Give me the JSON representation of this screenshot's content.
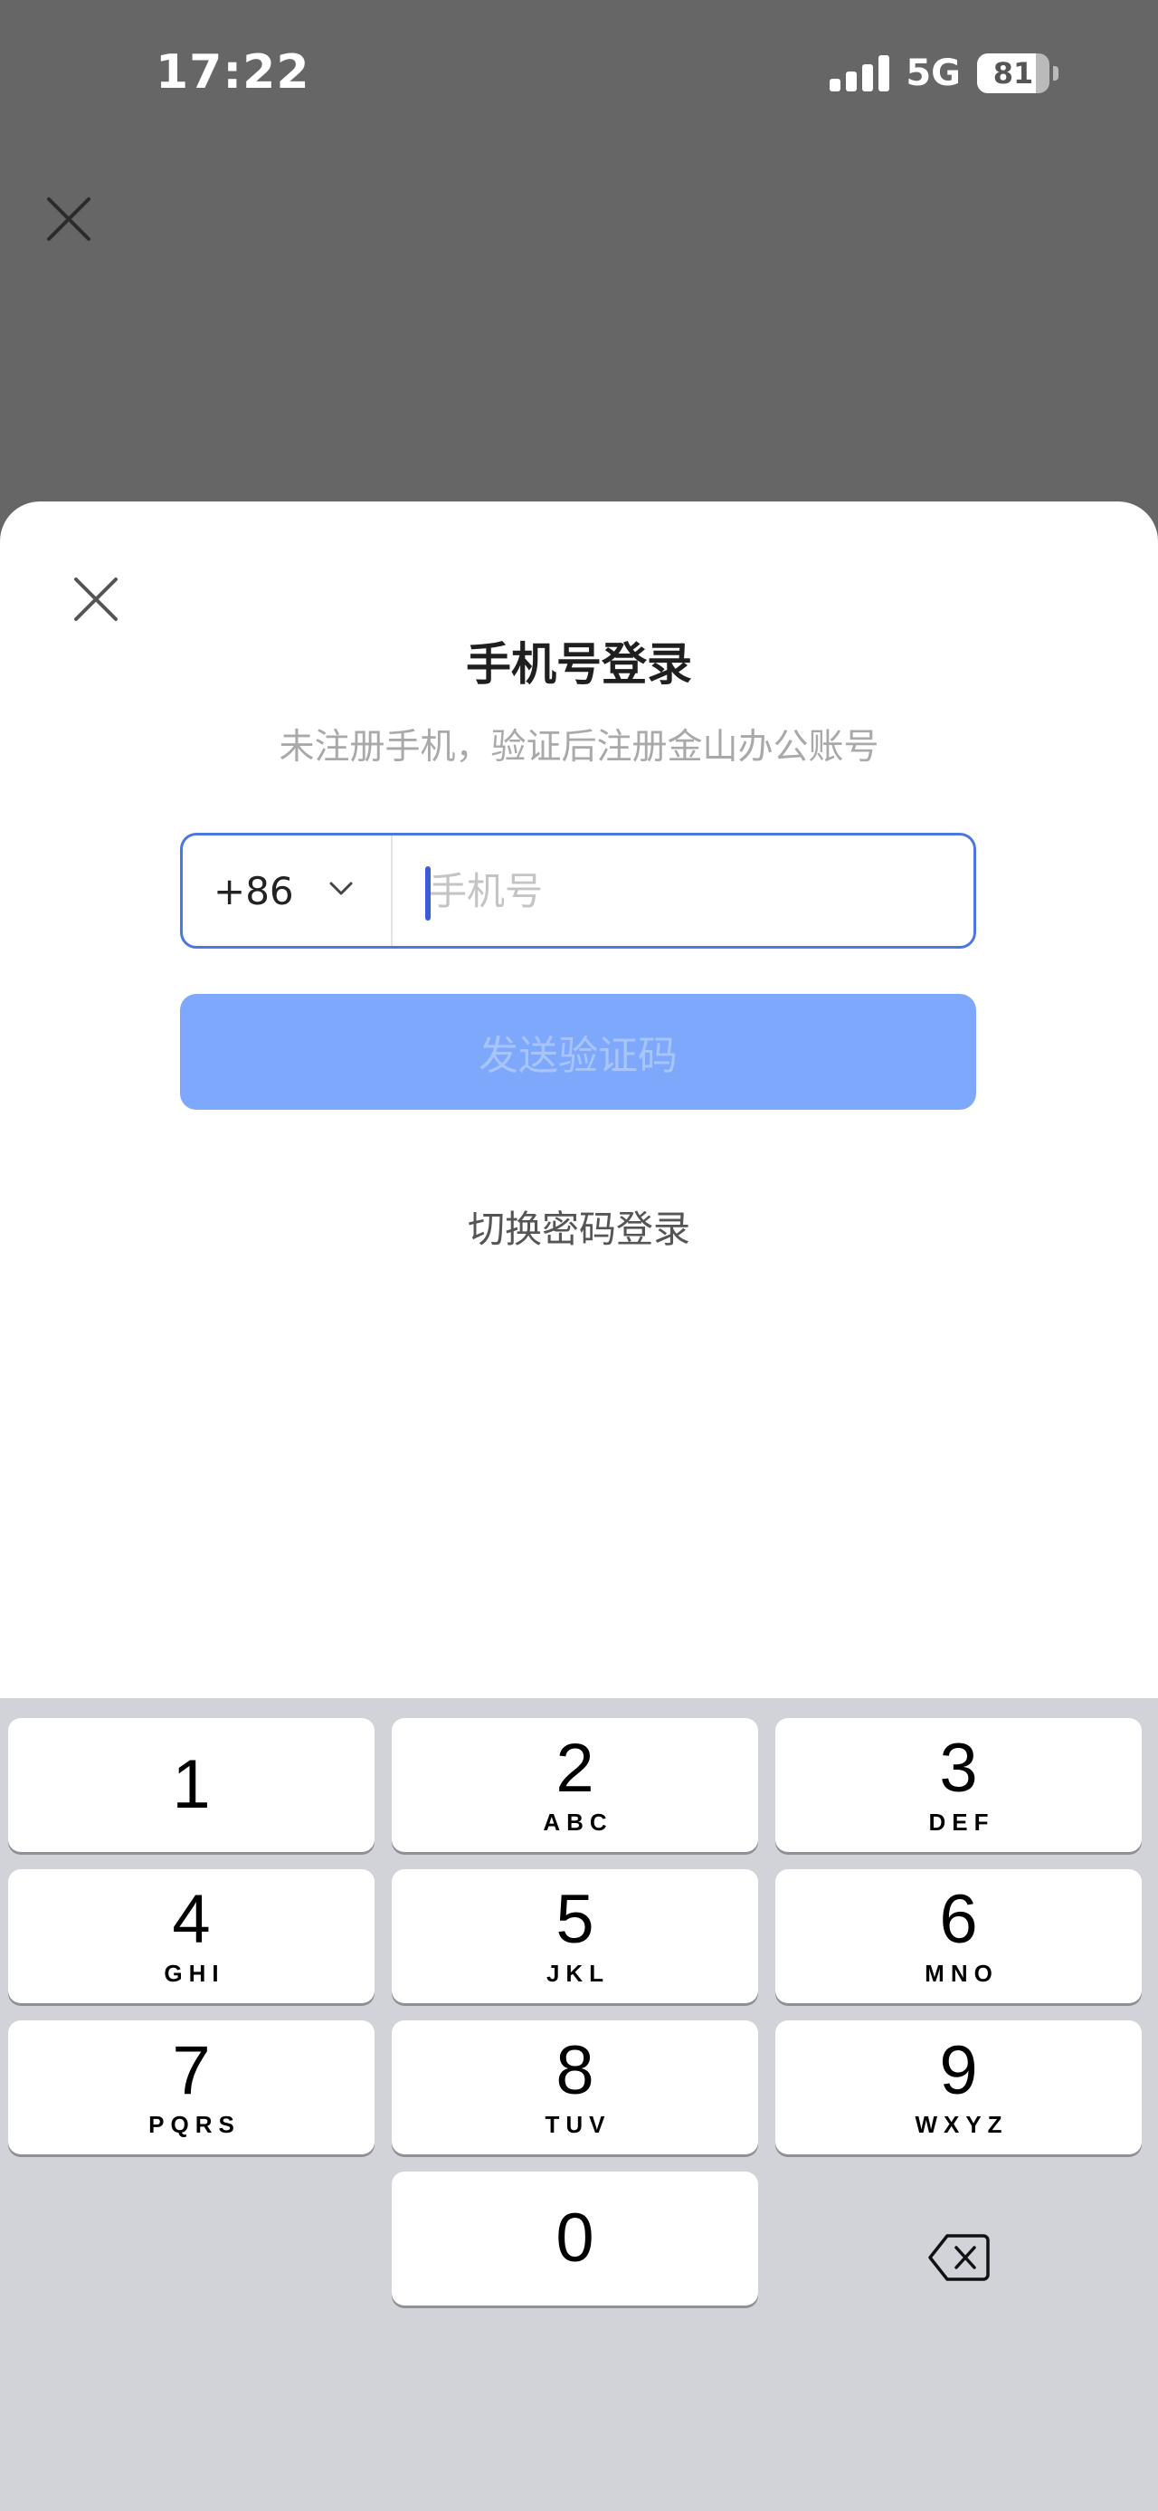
{
  "status_bar": {
    "time": "17:22",
    "network": "5G",
    "battery": "81",
    "battery_level": 0.81
  },
  "sheet": {
    "title": "手机号登录",
    "subtitle": "未注册手机，验证后注册金山办公账号",
    "country_code": "+86",
    "phone_placeholder": "手机号",
    "phone_value": "",
    "send_code_label": "发送验证码",
    "switch_login_label": "切换密码登录"
  },
  "colors": {
    "accent": "#4a78e0",
    "send_button_disabled": "#7ea8fb",
    "overlay": "#666666",
    "keyboard_bg": "#d1d3d9"
  },
  "keyboard": {
    "keys": [
      {
        "digit": "1",
        "letters": ""
      },
      {
        "digit": "2",
        "letters": "ABC"
      },
      {
        "digit": "3",
        "letters": "DEF"
      },
      {
        "digit": "4",
        "letters": "GHI"
      },
      {
        "digit": "5",
        "letters": "JKL"
      },
      {
        "digit": "6",
        "letters": "MNO"
      },
      {
        "digit": "7",
        "letters": "PQRS"
      },
      {
        "digit": "8",
        "letters": "TUV"
      },
      {
        "digit": "9",
        "letters": "WXYZ"
      },
      {
        "digit": "0",
        "letters": ""
      }
    ],
    "delete_icon": "backspace-icon"
  }
}
